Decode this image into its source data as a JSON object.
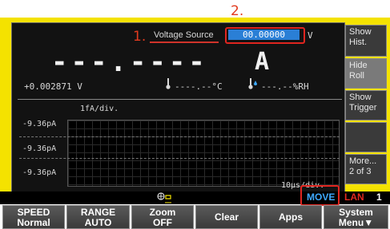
{
  "annotations": {
    "callout_1": "1.",
    "callout_2": "2."
  },
  "voltage_source": {
    "label": "Voltage Source",
    "value": "00.00000",
    "unit": "V"
  },
  "reading": {
    "value": "---.----",
    "unit": "A"
  },
  "status": {
    "voltage": "+0.002871 V",
    "temperature": "----.--°C",
    "humidity": "---.--%RH"
  },
  "graph": {
    "scale_label": "1fA/div.",
    "time_label": "10μs/div.",
    "y_labels": [
      "-9.36pA",
      "-9.36pA",
      "-9.36pA"
    ]
  },
  "side_menu": [
    {
      "label": "Show Hist."
    },
    {
      "label": "Hide Roll"
    },
    {
      "label": "Show Trigger"
    },
    {
      "label": ""
    },
    {
      "label": "More... 2 of 3"
    }
  ],
  "bottom_status": {
    "move": "MOVE",
    "lan": "LAN",
    "channel": "1"
  },
  "softkeys": [
    {
      "line1": "SPEED",
      "line2": "Normal"
    },
    {
      "line1": "RANGE",
      "line2": "AUTO"
    },
    {
      "line1": "Zoom",
      "line2": "OFF"
    },
    {
      "line1": "Clear",
      "line2": ""
    },
    {
      "line1": "Apps",
      "line2": ""
    },
    {
      "line1": "System",
      "line2": "Menu▼"
    }
  ],
  "colors": {
    "accent": "#2a7fd6",
    "callout": "#e0251f",
    "move": "#3ea9ff",
    "lan": "#e02a1f",
    "bezel": "#f4e200"
  }
}
